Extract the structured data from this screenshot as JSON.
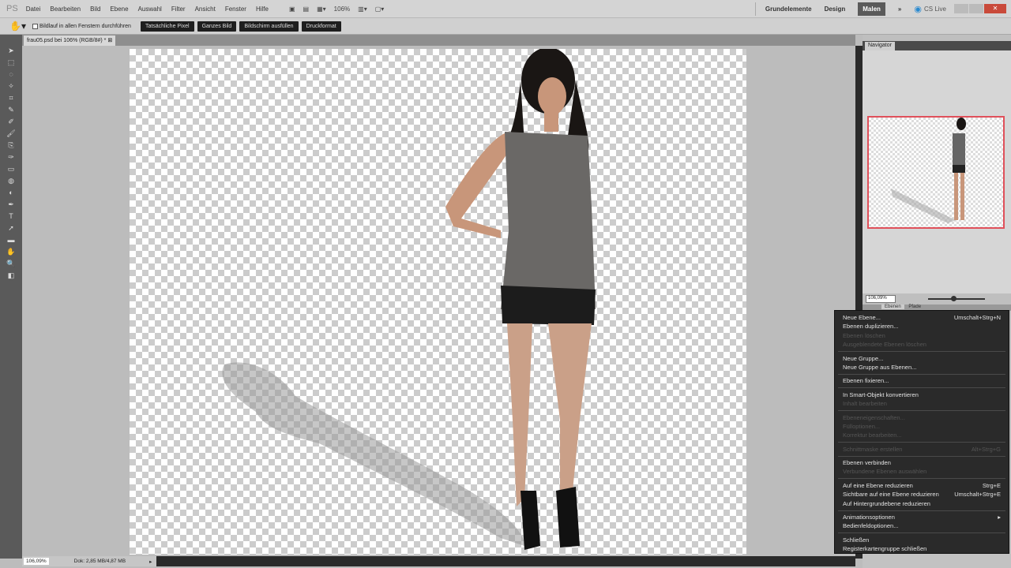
{
  "app": {
    "logo": "PS"
  },
  "menu": [
    "Datei",
    "Bearbeiten",
    "Bild",
    "Ebene",
    "Auswahl",
    "Filter",
    "Ansicht",
    "Fenster",
    "Hilfe"
  ],
  "appbar": {
    "zoom": "106%",
    "workspaces": [
      "Grundelemente",
      "Design",
      "Malen"
    ],
    "active_workspace": "Malen",
    "more": "»",
    "cslive": "CS Live"
  },
  "options": {
    "checkbox_label": "Bildlauf in allen Fenstern durchführen",
    "checked": false,
    "buttons": [
      "Tatsächliche Pixel",
      "Ganzes Bild",
      "Bildschirm ausfüllen",
      "Druckformat"
    ]
  },
  "document": {
    "tab_title": "frau05.psd bei 106% (RGB/8#) *"
  },
  "navigator": {
    "tab": "Navigator",
    "zoom": "106,09%",
    "slider_fraction": 0.45
  },
  "panels": {
    "tabs": [
      "Ebenen",
      "Pfade"
    ]
  },
  "status": {
    "zoom": "106,09%",
    "doc": "Dok: 2,85 MB/4,87 MB"
  },
  "context_menu": {
    "groups": [
      [
        {
          "label": "Neue Ebene...",
          "shortcut": "Umschalt+Strg+N",
          "enabled": true
        },
        {
          "label": "Ebenen duplizieren...",
          "enabled": true
        },
        {
          "label": "Ebenen löschen",
          "enabled": false
        },
        {
          "label": "Ausgeblendete Ebenen löschen",
          "enabled": false
        }
      ],
      [
        {
          "label": "Neue Gruppe...",
          "enabled": true
        },
        {
          "label": "Neue Gruppe aus Ebenen...",
          "enabled": true
        }
      ],
      [
        {
          "label": "Ebenen fixieren...",
          "enabled": true
        }
      ],
      [
        {
          "label": "In Smart-Objekt konvertieren",
          "enabled": true
        },
        {
          "label": "Inhalt bearbeiten",
          "enabled": false
        }
      ],
      [
        {
          "label": "Ebeneneigenschaften...",
          "enabled": false
        },
        {
          "label": "Fülloptionen...",
          "enabled": false
        },
        {
          "label": "Korrektur bearbeiten...",
          "enabled": false
        }
      ],
      [
        {
          "label": "Schnittmaske erstellen",
          "shortcut": "Alt+Strg+G",
          "enabled": false
        }
      ],
      [
        {
          "label": "Ebenen verbinden",
          "enabled": true
        },
        {
          "label": "Verbundene Ebenen auswählen",
          "enabled": false
        }
      ],
      [
        {
          "label": "Auf eine Ebene reduzieren",
          "shortcut": "Strg+E",
          "enabled": true
        },
        {
          "label": "Sichtbare auf eine Ebene reduzieren",
          "shortcut": "Umschalt+Strg+E",
          "enabled": true
        },
        {
          "label": "Auf Hintergrundebene reduzieren",
          "enabled": true
        }
      ],
      [
        {
          "label": "Animationsoptionen",
          "submenu": "▸",
          "enabled": true
        },
        {
          "label": "Bedienfeldoptionen...",
          "enabled": true
        }
      ],
      [
        {
          "label": "Schließen",
          "enabled": true
        },
        {
          "label": "Registerkartengruppe schließen",
          "enabled": true
        }
      ]
    ]
  },
  "colors": {
    "menu_bg": "#2a2a2a",
    "accent_red": "#e0505a",
    "close_button": "#c94a3a"
  }
}
